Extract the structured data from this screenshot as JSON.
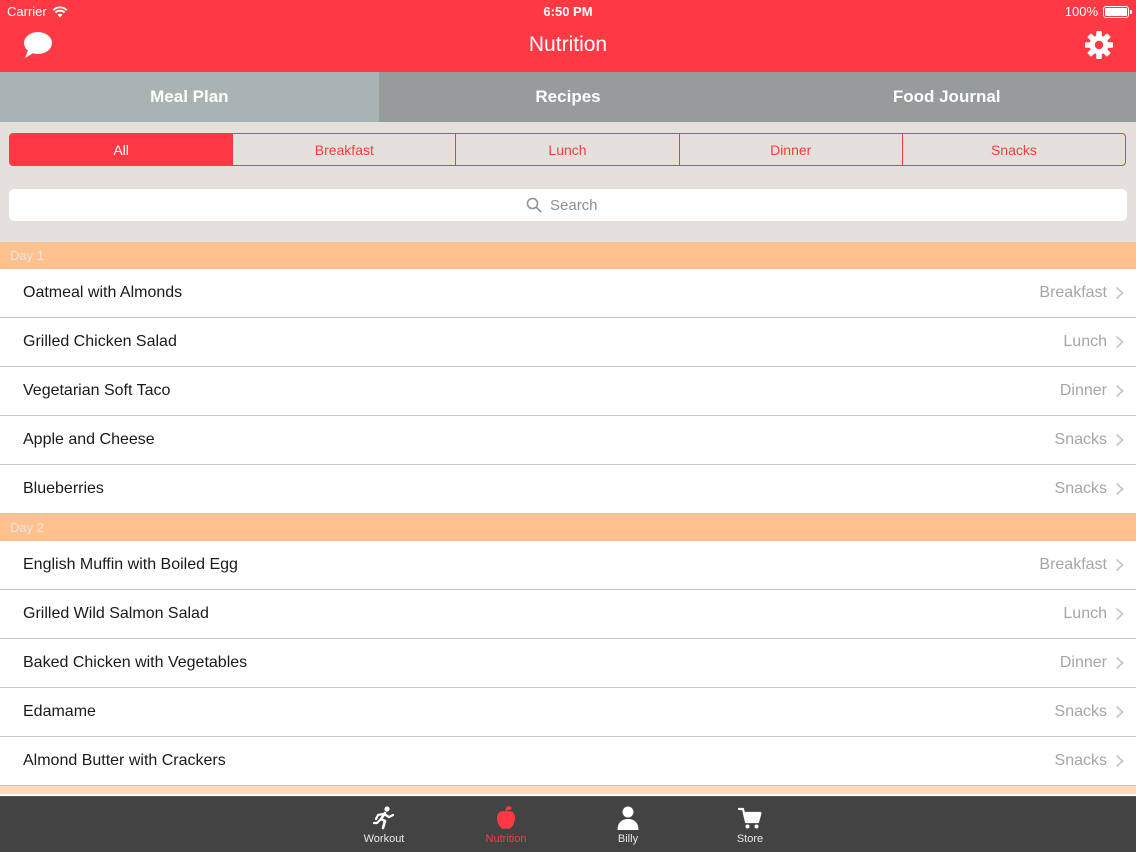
{
  "status": {
    "carrier": "Carrier",
    "time": "6:50 PM",
    "battery": "100%"
  },
  "nav": {
    "title": "Nutrition"
  },
  "tabs": [
    {
      "label": "Meal Plan",
      "active": true
    },
    {
      "label": "Recipes",
      "active": false
    },
    {
      "label": "Food Journal",
      "active": false
    }
  ],
  "filters": [
    {
      "label": "All",
      "active": true
    },
    {
      "label": "Breakfast",
      "active": false
    },
    {
      "label": "Lunch",
      "active": false
    },
    {
      "label": "Dinner",
      "active": false
    },
    {
      "label": "Snacks",
      "active": false
    }
  ],
  "search": {
    "placeholder": "Search"
  },
  "sections": [
    {
      "title": "Day 1",
      "items": [
        {
          "name": "Oatmeal with Almonds",
          "meal": "Breakfast"
        },
        {
          "name": "Grilled Chicken Salad",
          "meal": "Lunch"
        },
        {
          "name": "Vegetarian Soft Taco",
          "meal": "Dinner"
        },
        {
          "name": "Apple and Cheese",
          "meal": "Snacks"
        },
        {
          "name": "Blueberries",
          "meal": "Snacks"
        }
      ]
    },
    {
      "title": "Day 2",
      "items": [
        {
          "name": "English Muffin with Boiled Egg",
          "meal": "Breakfast"
        },
        {
          "name": "Grilled Wild Salmon Salad",
          "meal": "Lunch"
        },
        {
          "name": "Baked Chicken with Vegetables",
          "meal": "Dinner"
        },
        {
          "name": "Edamame",
          "meal": "Snacks"
        },
        {
          "name": "Almond Butter with Crackers",
          "meal": "Snacks"
        }
      ]
    }
  ],
  "tabbar": [
    {
      "label": "Workout",
      "icon": "runner-icon",
      "active": false
    },
    {
      "label": "Nutrition",
      "icon": "apple-icon",
      "active": true
    },
    {
      "label": "Billy",
      "icon": "person-icon",
      "active": false
    },
    {
      "label": "Store",
      "icon": "cart-icon",
      "active": false
    }
  ],
  "colors": {
    "accent": "#fd3a43",
    "section_header": "#ffc28e",
    "tabs_bg": "#969b9c",
    "tab_active_bg": "#aab3b3",
    "filter_bg": "#e4e0db",
    "tabbar_bg": "#434343"
  }
}
